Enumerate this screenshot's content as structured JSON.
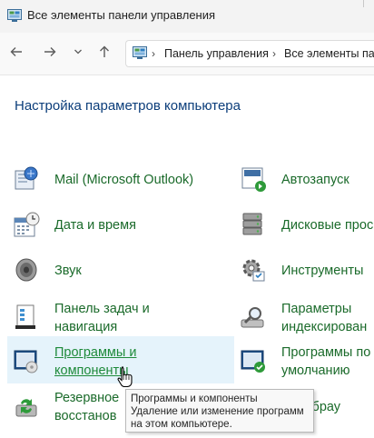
{
  "window": {
    "title": "Все элементы панели управления"
  },
  "breadcrumb": [
    "Панель управления",
    "Все элементы па"
  ],
  "heading": "Настройка параметров компьютера",
  "items_left": [
    {
      "label_lines": [
        "Mail (Microsoft Outlook)"
      ],
      "icon": "mail-icon"
    },
    {
      "label_lines": [
        "Дата и время"
      ],
      "icon": "calendar-clock-icon"
    },
    {
      "label_lines": [
        "Звук"
      ],
      "icon": "speaker-icon"
    },
    {
      "label_lines": [
        "Панель задач и",
        "навигация"
      ],
      "icon": "taskbar-icon"
    },
    {
      "label_lines": [
        "Программы и",
        "компоненты"
      ],
      "icon": "programs-icon"
    },
    {
      "label_lines": [
        "Резервное",
        "восстанов"
      ],
      "icon": "backup-icon"
    }
  ],
  "items_right": [
    {
      "label_lines": [
        "Автозапуск"
      ],
      "icon": "autoplay-icon"
    },
    {
      "label_lines": [
        "Дисковые прос"
      ],
      "icon": "storage-icon"
    },
    {
      "label_lines": [
        "Инструменты"
      ],
      "icon": "tools-icon"
    },
    {
      "label_lines": [
        "Параметры",
        "индексирован"
      ],
      "icon": "indexing-icon"
    },
    {
      "label_lines": [
        "Программы по",
        "умолчанию"
      ],
      "icon": "default-programs-icon"
    },
    {
      "label_lines": [
        "ства брау"
      ],
      "icon": "browser-icon"
    }
  ],
  "tooltip": {
    "lines": [
      "Программы и компоненты",
      "Удаление или изменение программ",
      "на этом компьютере."
    ]
  }
}
